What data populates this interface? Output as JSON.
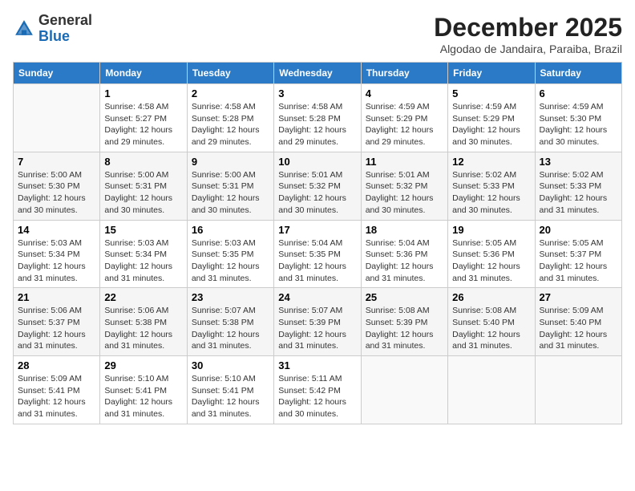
{
  "header": {
    "logo_general": "General",
    "logo_blue": "Blue",
    "month_year": "December 2025",
    "location": "Algodao de Jandaira, Paraiba, Brazil"
  },
  "days_of_week": [
    "Sunday",
    "Monday",
    "Tuesday",
    "Wednesday",
    "Thursday",
    "Friday",
    "Saturday"
  ],
  "weeks": [
    [
      {
        "day": "",
        "detail": ""
      },
      {
        "day": "1",
        "detail": "Sunrise: 4:58 AM\nSunset: 5:27 PM\nDaylight: 12 hours\nand 29 minutes."
      },
      {
        "day": "2",
        "detail": "Sunrise: 4:58 AM\nSunset: 5:28 PM\nDaylight: 12 hours\nand 29 minutes."
      },
      {
        "day": "3",
        "detail": "Sunrise: 4:58 AM\nSunset: 5:28 PM\nDaylight: 12 hours\nand 29 minutes."
      },
      {
        "day": "4",
        "detail": "Sunrise: 4:59 AM\nSunset: 5:29 PM\nDaylight: 12 hours\nand 29 minutes."
      },
      {
        "day": "5",
        "detail": "Sunrise: 4:59 AM\nSunset: 5:29 PM\nDaylight: 12 hours\nand 30 minutes."
      },
      {
        "day": "6",
        "detail": "Sunrise: 4:59 AM\nSunset: 5:30 PM\nDaylight: 12 hours\nand 30 minutes."
      }
    ],
    [
      {
        "day": "7",
        "detail": "Sunrise: 5:00 AM\nSunset: 5:30 PM\nDaylight: 12 hours\nand 30 minutes."
      },
      {
        "day": "8",
        "detail": "Sunrise: 5:00 AM\nSunset: 5:31 PM\nDaylight: 12 hours\nand 30 minutes."
      },
      {
        "day": "9",
        "detail": "Sunrise: 5:00 AM\nSunset: 5:31 PM\nDaylight: 12 hours\nand 30 minutes."
      },
      {
        "day": "10",
        "detail": "Sunrise: 5:01 AM\nSunset: 5:32 PM\nDaylight: 12 hours\nand 30 minutes."
      },
      {
        "day": "11",
        "detail": "Sunrise: 5:01 AM\nSunset: 5:32 PM\nDaylight: 12 hours\nand 30 minutes."
      },
      {
        "day": "12",
        "detail": "Sunrise: 5:02 AM\nSunset: 5:33 PM\nDaylight: 12 hours\nand 30 minutes."
      },
      {
        "day": "13",
        "detail": "Sunrise: 5:02 AM\nSunset: 5:33 PM\nDaylight: 12 hours\nand 31 minutes."
      }
    ],
    [
      {
        "day": "14",
        "detail": "Sunrise: 5:03 AM\nSunset: 5:34 PM\nDaylight: 12 hours\nand 31 minutes."
      },
      {
        "day": "15",
        "detail": "Sunrise: 5:03 AM\nSunset: 5:34 PM\nDaylight: 12 hours\nand 31 minutes."
      },
      {
        "day": "16",
        "detail": "Sunrise: 5:03 AM\nSunset: 5:35 PM\nDaylight: 12 hours\nand 31 minutes."
      },
      {
        "day": "17",
        "detail": "Sunrise: 5:04 AM\nSunset: 5:35 PM\nDaylight: 12 hours\nand 31 minutes."
      },
      {
        "day": "18",
        "detail": "Sunrise: 5:04 AM\nSunset: 5:36 PM\nDaylight: 12 hours\nand 31 minutes."
      },
      {
        "day": "19",
        "detail": "Sunrise: 5:05 AM\nSunset: 5:36 PM\nDaylight: 12 hours\nand 31 minutes."
      },
      {
        "day": "20",
        "detail": "Sunrise: 5:05 AM\nSunset: 5:37 PM\nDaylight: 12 hours\nand 31 minutes."
      }
    ],
    [
      {
        "day": "21",
        "detail": "Sunrise: 5:06 AM\nSunset: 5:37 PM\nDaylight: 12 hours\nand 31 minutes."
      },
      {
        "day": "22",
        "detail": "Sunrise: 5:06 AM\nSunset: 5:38 PM\nDaylight: 12 hours\nand 31 minutes."
      },
      {
        "day": "23",
        "detail": "Sunrise: 5:07 AM\nSunset: 5:38 PM\nDaylight: 12 hours\nand 31 minutes."
      },
      {
        "day": "24",
        "detail": "Sunrise: 5:07 AM\nSunset: 5:39 PM\nDaylight: 12 hours\nand 31 minutes."
      },
      {
        "day": "25",
        "detail": "Sunrise: 5:08 AM\nSunset: 5:39 PM\nDaylight: 12 hours\nand 31 minutes."
      },
      {
        "day": "26",
        "detail": "Sunrise: 5:08 AM\nSunset: 5:40 PM\nDaylight: 12 hours\nand 31 minutes."
      },
      {
        "day": "27",
        "detail": "Sunrise: 5:09 AM\nSunset: 5:40 PM\nDaylight: 12 hours\nand 31 minutes."
      }
    ],
    [
      {
        "day": "28",
        "detail": "Sunrise: 5:09 AM\nSunset: 5:41 PM\nDaylight: 12 hours\nand 31 minutes."
      },
      {
        "day": "29",
        "detail": "Sunrise: 5:10 AM\nSunset: 5:41 PM\nDaylight: 12 hours\nand 31 minutes."
      },
      {
        "day": "30",
        "detail": "Sunrise: 5:10 AM\nSunset: 5:41 PM\nDaylight: 12 hours\nand 31 minutes."
      },
      {
        "day": "31",
        "detail": "Sunrise: 5:11 AM\nSunset: 5:42 PM\nDaylight: 12 hours\nand 30 minutes."
      },
      {
        "day": "",
        "detail": ""
      },
      {
        "day": "",
        "detail": ""
      },
      {
        "day": "",
        "detail": ""
      }
    ]
  ]
}
